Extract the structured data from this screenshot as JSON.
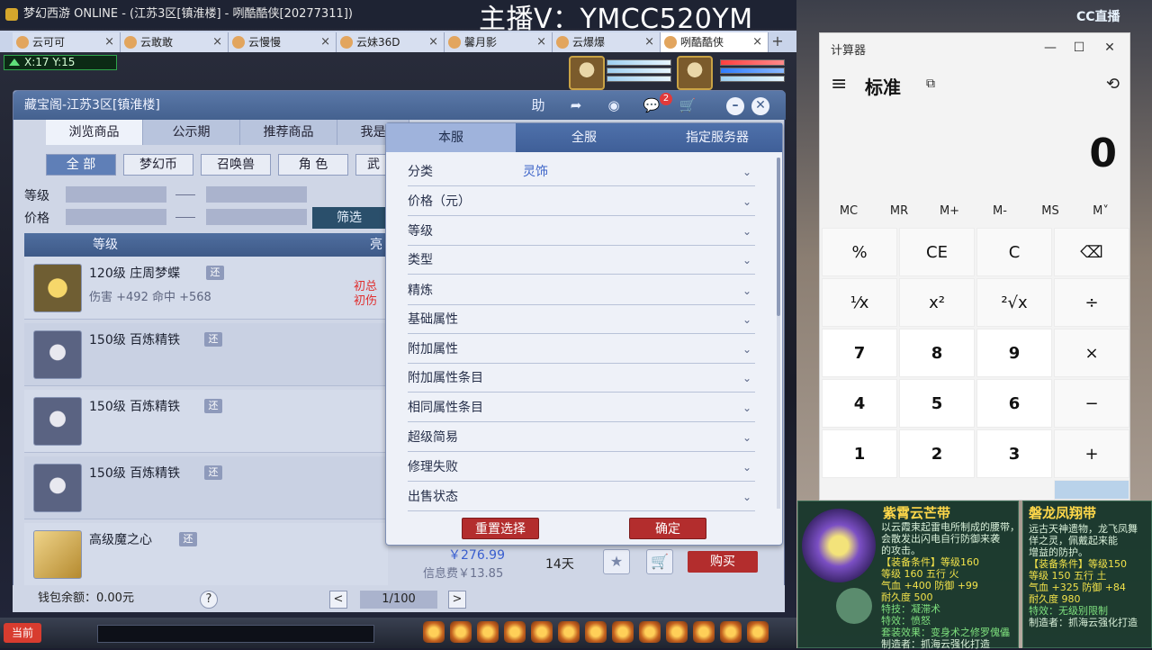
{
  "window": {
    "title": "梦幻西游 ONLINE - (江苏3区[镇淮楼] - 咧酷酷侠[20277311])",
    "streamer_label": "主播V：YMCC520YM"
  },
  "browser_tabs": [
    {
      "label": "云可可"
    },
    {
      "label": "云敢敢"
    },
    {
      "label": "云慢慢"
    },
    {
      "label": "云妹36D"
    },
    {
      "label": "馨月影"
    },
    {
      "label": "云爆爆"
    },
    {
      "label": "咧酷酷侠",
      "active": true
    }
  ],
  "tab_close_glyph": "×",
  "tab_add_glyph": "+",
  "coords": "X:17 Y:15",
  "dialog": {
    "title": "藏宝阁-江苏3区[镇淮楼]",
    "header_icons": [
      "助",
      "share-icon",
      "record-icon",
      "chat-icon",
      "cart-icon"
    ],
    "chat_badge": "2",
    "minimize_glyph": "–",
    "close_glyph": "✕",
    "main_tabs": [
      "浏览商品",
      "公示期",
      "推荐商品",
      "我是"
    ],
    "categories": [
      "全 部",
      "梦幻币",
      "召唤兽",
      "角 色",
      "武"
    ],
    "level_label": "等级",
    "price_label": "价格",
    "filter_button": "筛选",
    "list_headers": {
      "level": "等级",
      "highlight": "亮"
    },
    "items": [
      {
        "name": "120级 庄周梦蝶",
        "sub": "伤害 +492 命中 +568",
        "tag": "还"
      },
      {
        "name": "150级 百炼精铁",
        "sub": "",
        "tag": "还"
      },
      {
        "name": "150级 百炼精铁",
        "sub": "",
        "tag": "还"
      },
      {
        "name": "150级 百炼精铁",
        "sub": "",
        "tag": "还"
      },
      {
        "name": "高级魔之心",
        "sub": "",
        "tag": "还"
      }
    ],
    "red_text": [
      "初总",
      "初伤"
    ],
    "last_item_price": "￥276.99",
    "last_item_fee": "信息费￥13.85",
    "last_item_days": "14天",
    "buy_button": "购买",
    "footer": {
      "wallet": "钱包余额：0.00元",
      "help_glyph": "?",
      "prev_glyph": "<",
      "page": "1/100",
      "next_glyph": ">"
    }
  },
  "filter_panel": {
    "tabs": [
      "本服",
      "全服",
      "指定服务器"
    ],
    "rows": [
      {
        "label": "分类",
        "value": "灵饰"
      },
      {
        "label": "价格（元）",
        "value": ""
      },
      {
        "label": "等级",
        "value": ""
      },
      {
        "label": "类型",
        "value": ""
      },
      {
        "label": "精炼",
        "value": ""
      },
      {
        "label": "基础属性",
        "value": ""
      },
      {
        "label": "附加属性",
        "value": ""
      },
      {
        "label": "附加属性条目",
        "value": ""
      },
      {
        "label": "相同属性条目",
        "value": ""
      },
      {
        "label": "超级简易",
        "value": ""
      },
      {
        "label": "修理失败",
        "value": ""
      },
      {
        "label": "出售状态",
        "value": ""
      }
    ],
    "chevron_glyph": "⌄",
    "reset_button": "重置选择",
    "confirm_button": "确定"
  },
  "bottom_bar": {
    "current_button": "当前"
  },
  "calculator": {
    "title": "计算器",
    "mode": "标准",
    "display": "0",
    "memory_keys": [
      "MC",
      "MR",
      "M+",
      "M-",
      "MS",
      "M˅"
    ],
    "keys": [
      [
        "%",
        "CE",
        "C",
        "⌫"
      ],
      [
        "¹⁄x",
        "x²",
        "²√x",
        "÷"
      ],
      [
        "7",
        "8",
        "9",
        "×"
      ],
      [
        "4",
        "5",
        "6",
        "−"
      ],
      [
        "1",
        "2",
        "3",
        "+"
      ]
    ],
    "menu_glyph": "≡",
    "history_glyph": "⟲",
    "window_buttons": [
      "—",
      "☐",
      "✕"
    ]
  },
  "overlay": {
    "logo": "CC直播",
    "tooltip1": {
      "title": "紫霄云芒带",
      "lines": [
        "以云霞束起雷电所制成的腰带，",
        "会散发出闪电自行防御来袭",
        "的攻击。",
        "【装备条件】等级160",
        "等级 160  五行 火",
        "气血 +400 防御 +99",
        "耐久度 500",
        "特技：凝滞术",
        "特效：愤怒",
        "套装效果：变身术之修罗傀儡",
        "制造者：抓海云强化打造"
      ]
    },
    "tooltip2": {
      "title": "磐龙凤翔带",
      "lines": [
        "远古天神遗物，龙飞凤舞",
        "佯之灵，佩戴起来能",
        "增益的防护。",
        "【装备条件】等级150",
        "等级 150  五行 土",
        "气血 +325 防御 +84",
        "耐久度 980",
        "特效：无级别限制",
        "制造者：抓海云强化打造"
      ]
    }
  },
  "colors": {
    "accent_red": "#b32d2d",
    "dialog_blue": "#44618f",
    "link_blue": "#3f66c9"
  }
}
